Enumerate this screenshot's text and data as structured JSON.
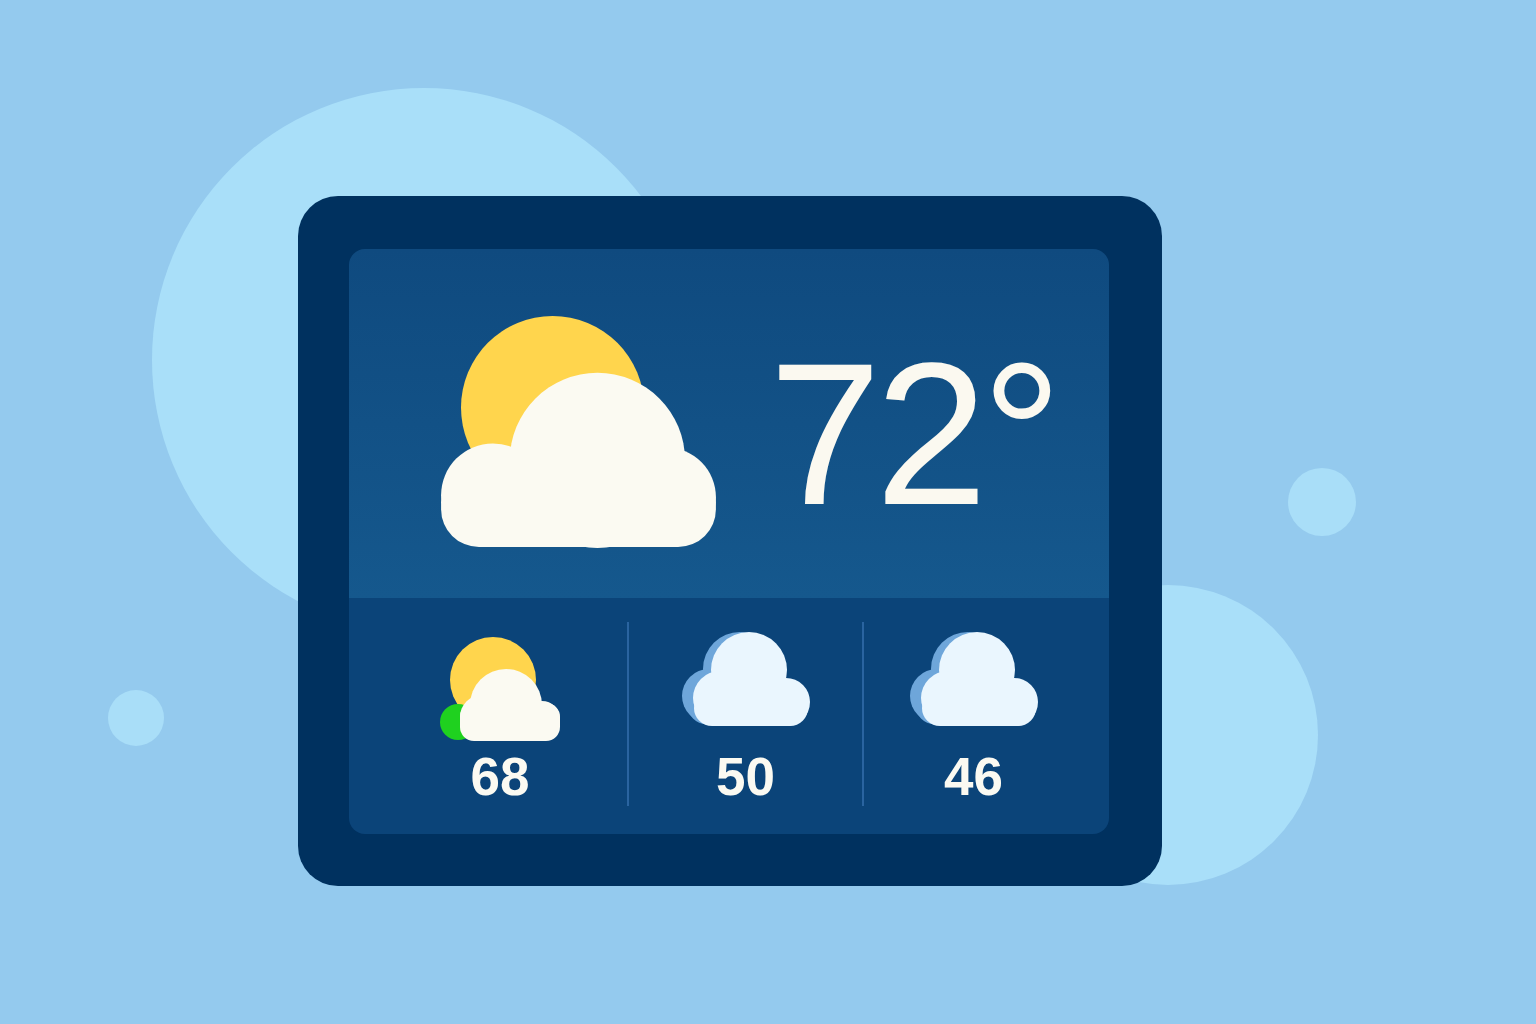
{
  "current": {
    "kind": "partly-sunny",
    "temperature": "72°"
  },
  "forecast": [
    {
      "kind": "partly-sunny",
      "temperature": "68"
    },
    {
      "kind": "cloudy",
      "temperature": "50"
    },
    {
      "kind": "cloudy",
      "temperature": "46"
    }
  ]
}
